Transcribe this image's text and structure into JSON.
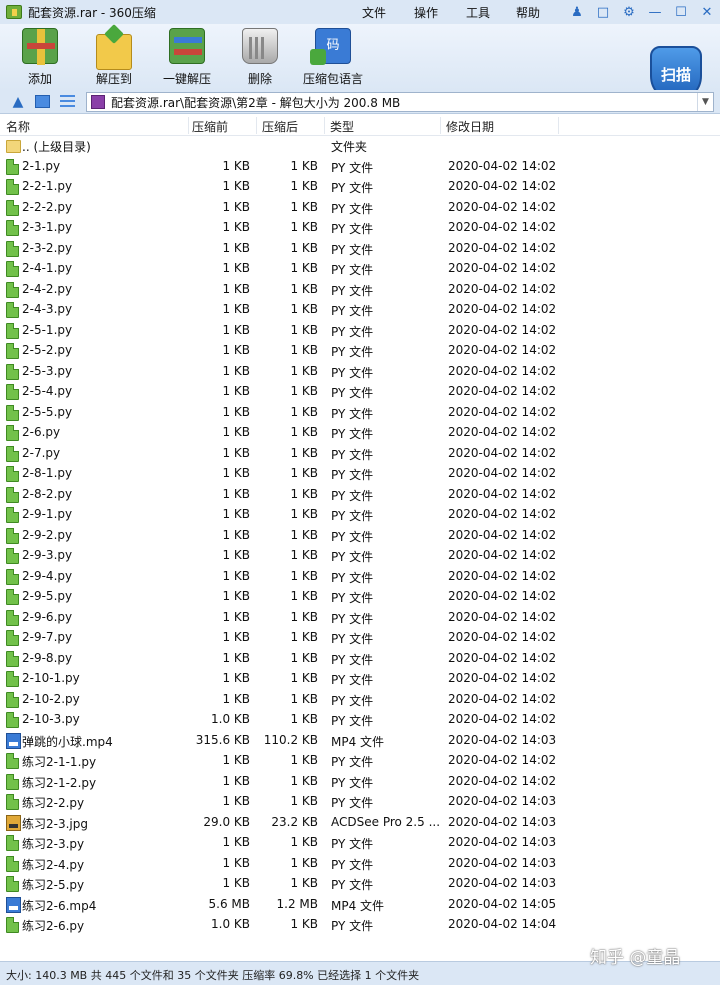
{
  "window": {
    "title": "配套资源.rar - 360压缩",
    "menus": [
      "文件",
      "操作",
      "工具",
      "帮助"
    ]
  },
  "toolbar": {
    "add_label": "添加",
    "extract_label": "解压到",
    "oneclick_label": "一键解压",
    "delete_label": "删除",
    "lang_label": "压缩包语言",
    "lang_icon_text": "码",
    "scan_label": "扫描"
  },
  "address": {
    "path": "配套资源.rar\\配套资源\\第2章 - 解包大小为 200.8 MB"
  },
  "columns": {
    "name": "名称",
    "packed": "压缩前",
    "size": "压缩后",
    "type": "类型",
    "date": "修改日期"
  },
  "files": [
    {
      "name": ".. (上级目录)",
      "packed": "",
      "size": "",
      "type": "文件夹",
      "date": "",
      "icon": "folder"
    },
    {
      "name": "2-1.py",
      "packed": "1 KB",
      "size": "1 KB",
      "type": "PY 文件",
      "date": "2020-04-02 14:02",
      "icon": "py"
    },
    {
      "name": "2-2-1.py",
      "packed": "1 KB",
      "size": "1 KB",
      "type": "PY 文件",
      "date": "2020-04-02 14:02",
      "icon": "py"
    },
    {
      "name": "2-2-2.py",
      "packed": "1 KB",
      "size": "1 KB",
      "type": "PY 文件",
      "date": "2020-04-02 14:02",
      "icon": "py"
    },
    {
      "name": "2-3-1.py",
      "packed": "1 KB",
      "size": "1 KB",
      "type": "PY 文件",
      "date": "2020-04-02 14:02",
      "icon": "py"
    },
    {
      "name": "2-3-2.py",
      "packed": "1 KB",
      "size": "1 KB",
      "type": "PY 文件",
      "date": "2020-04-02 14:02",
      "icon": "py"
    },
    {
      "name": "2-4-1.py",
      "packed": "1 KB",
      "size": "1 KB",
      "type": "PY 文件",
      "date": "2020-04-02 14:02",
      "icon": "py"
    },
    {
      "name": "2-4-2.py",
      "packed": "1 KB",
      "size": "1 KB",
      "type": "PY 文件",
      "date": "2020-04-02 14:02",
      "icon": "py"
    },
    {
      "name": "2-4-3.py",
      "packed": "1 KB",
      "size": "1 KB",
      "type": "PY 文件",
      "date": "2020-04-02 14:02",
      "icon": "py"
    },
    {
      "name": "2-5-1.py",
      "packed": "1 KB",
      "size": "1 KB",
      "type": "PY 文件",
      "date": "2020-04-02 14:02",
      "icon": "py"
    },
    {
      "name": "2-5-2.py",
      "packed": "1 KB",
      "size": "1 KB",
      "type": "PY 文件",
      "date": "2020-04-02 14:02",
      "icon": "py"
    },
    {
      "name": "2-5-3.py",
      "packed": "1 KB",
      "size": "1 KB",
      "type": "PY 文件",
      "date": "2020-04-02 14:02",
      "icon": "py"
    },
    {
      "name": "2-5-4.py",
      "packed": "1 KB",
      "size": "1 KB",
      "type": "PY 文件",
      "date": "2020-04-02 14:02",
      "icon": "py"
    },
    {
      "name": "2-5-5.py",
      "packed": "1 KB",
      "size": "1 KB",
      "type": "PY 文件",
      "date": "2020-04-02 14:02",
      "icon": "py"
    },
    {
      "name": "2-6.py",
      "packed": "1 KB",
      "size": "1 KB",
      "type": "PY 文件",
      "date": "2020-04-02 14:02",
      "icon": "py"
    },
    {
      "name": "2-7.py",
      "packed": "1 KB",
      "size": "1 KB",
      "type": "PY 文件",
      "date": "2020-04-02 14:02",
      "icon": "py"
    },
    {
      "name": "2-8-1.py",
      "packed": "1 KB",
      "size": "1 KB",
      "type": "PY 文件",
      "date": "2020-04-02 14:02",
      "icon": "py"
    },
    {
      "name": "2-8-2.py",
      "packed": "1 KB",
      "size": "1 KB",
      "type": "PY 文件",
      "date": "2020-04-02 14:02",
      "icon": "py"
    },
    {
      "name": "2-9-1.py",
      "packed": "1 KB",
      "size": "1 KB",
      "type": "PY 文件",
      "date": "2020-04-02 14:02",
      "icon": "py"
    },
    {
      "name": "2-9-2.py",
      "packed": "1 KB",
      "size": "1 KB",
      "type": "PY 文件",
      "date": "2020-04-02 14:02",
      "icon": "py"
    },
    {
      "name": "2-9-3.py",
      "packed": "1 KB",
      "size": "1 KB",
      "type": "PY 文件",
      "date": "2020-04-02 14:02",
      "icon": "py"
    },
    {
      "name": "2-9-4.py",
      "packed": "1 KB",
      "size": "1 KB",
      "type": "PY 文件",
      "date": "2020-04-02 14:02",
      "icon": "py"
    },
    {
      "name": "2-9-5.py",
      "packed": "1 KB",
      "size": "1 KB",
      "type": "PY 文件",
      "date": "2020-04-02 14:02",
      "icon": "py"
    },
    {
      "name": "2-9-6.py",
      "packed": "1 KB",
      "size": "1 KB",
      "type": "PY 文件",
      "date": "2020-04-02 14:02",
      "icon": "py"
    },
    {
      "name": "2-9-7.py",
      "packed": "1 KB",
      "size": "1 KB",
      "type": "PY 文件",
      "date": "2020-04-02 14:02",
      "icon": "py"
    },
    {
      "name": "2-9-8.py",
      "packed": "1 KB",
      "size": "1 KB",
      "type": "PY 文件",
      "date": "2020-04-02 14:02",
      "icon": "py"
    },
    {
      "name": "2-10-1.py",
      "packed": "1 KB",
      "size": "1 KB",
      "type": "PY 文件",
      "date": "2020-04-02 14:02",
      "icon": "py"
    },
    {
      "name": "2-10-2.py",
      "packed": "1 KB",
      "size": "1 KB",
      "type": "PY 文件",
      "date": "2020-04-02 14:02",
      "icon": "py"
    },
    {
      "name": "2-10-3.py",
      "packed": "1.0 KB",
      "size": "1 KB",
      "type": "PY 文件",
      "date": "2020-04-02 14:02",
      "icon": "py"
    },
    {
      "name": "弹跳的小球.mp4",
      "packed": "315.6 KB",
      "size": "110.2 KB",
      "type": "MP4 文件",
      "date": "2020-04-02 14:03",
      "icon": "mp4"
    },
    {
      "name": "练习2-1-1.py",
      "packed": "1 KB",
      "size": "1 KB",
      "type": "PY 文件",
      "date": "2020-04-02 14:02",
      "icon": "py"
    },
    {
      "name": "练习2-1-2.py",
      "packed": "1 KB",
      "size": "1 KB",
      "type": "PY 文件",
      "date": "2020-04-02 14:02",
      "icon": "py"
    },
    {
      "name": "练习2-2.py",
      "packed": "1 KB",
      "size": "1 KB",
      "type": "PY 文件",
      "date": "2020-04-02 14:03",
      "icon": "py"
    },
    {
      "name": "练习2-3.jpg",
      "packed": "29.0 KB",
      "size": "23.2 KB",
      "type": "ACDSee Pro 2.5 ...",
      "date": "2020-04-02 14:03",
      "icon": "jpg"
    },
    {
      "name": "练习2-3.py",
      "packed": "1 KB",
      "size": "1 KB",
      "type": "PY 文件",
      "date": "2020-04-02 14:03",
      "icon": "py"
    },
    {
      "name": "练习2-4.py",
      "packed": "1 KB",
      "size": "1 KB",
      "type": "PY 文件",
      "date": "2020-04-02 14:03",
      "icon": "py"
    },
    {
      "name": "练习2-5.py",
      "packed": "1 KB",
      "size": "1 KB",
      "type": "PY 文件",
      "date": "2020-04-02 14:03",
      "icon": "py"
    },
    {
      "name": "练习2-6.mp4",
      "packed": "5.6 MB",
      "size": "1.2 MB",
      "type": "MP4 文件",
      "date": "2020-04-02 14:05",
      "icon": "mp4"
    },
    {
      "name": "练习2-6.py",
      "packed": "1.0 KB",
      "size": "1 KB",
      "type": "PY 文件",
      "date": "2020-04-02 14:04",
      "icon": "py"
    }
  ],
  "status": {
    "text": "大小: 140.3 MB 共 445 个文件和 35 个文件夹 压缩率 69.8% 已经选择 1 个文件夹"
  },
  "watermark": "知乎 @童晶"
}
